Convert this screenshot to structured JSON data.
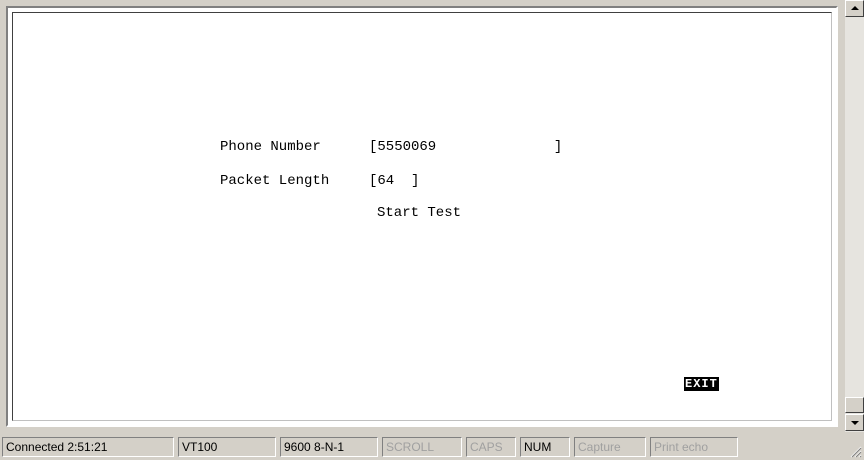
{
  "terminal": {
    "phone_label": "Phone Number",
    "phone_value": "[5550069              ]",
    "packet_label": "Packet Length",
    "packet_value": "[64  ]",
    "start_test": "Start Test",
    "exit": "EXIT"
  },
  "statusbar": {
    "connected": "Connected 2:51:21",
    "emulation": "VT100",
    "port_settings": "9600 8-N-1",
    "scroll": "SCROLL",
    "caps": "CAPS",
    "num": "NUM",
    "capture": "Capture",
    "print_echo": "Print echo"
  },
  "icons": {
    "scroll_up": "arrow-up-icon",
    "scroll_down": "arrow-down-icon",
    "resize": "resize-grip-icon"
  }
}
